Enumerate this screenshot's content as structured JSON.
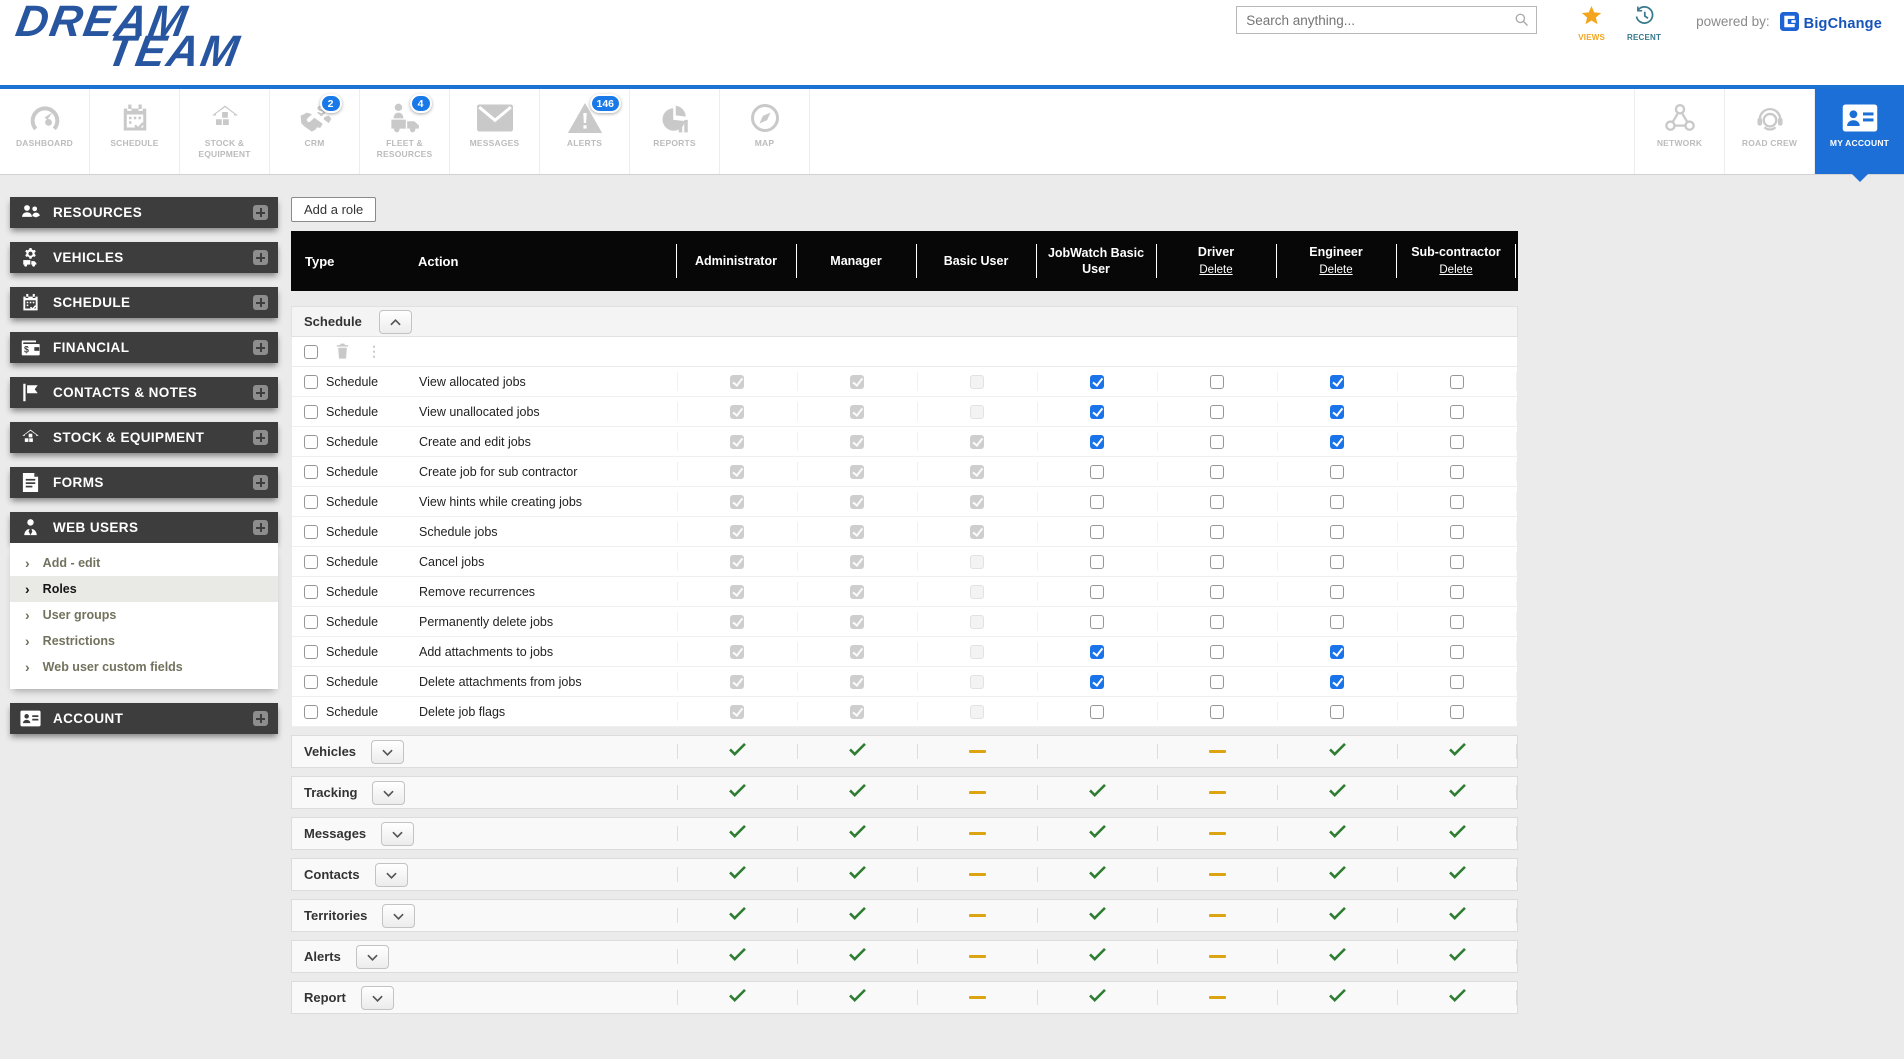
{
  "brand": {
    "logo_line1": "DREAM",
    "logo_line2": "TEAM",
    "powered_by": "powered by:",
    "powered_brand": "BigChange"
  },
  "topbar": {
    "search_placeholder": "Search anything...",
    "views_label": "VIEWS",
    "recent_label": "RECENT"
  },
  "colors": {
    "accent_blue": "#1b6fd6",
    "checkbox_blue": "#1a73e8",
    "check_green": "#2e7d32",
    "dash_orange": "#dba412",
    "header_black": "#070707",
    "sidebar_dark": "#3d3d3d"
  },
  "nav": {
    "items": [
      {
        "label": "DASHBOARD",
        "icon": "dashboard-icon"
      },
      {
        "label": "SCHEDULE",
        "icon": "schedule-icon"
      },
      {
        "label": "STOCK & EQUIPMENT",
        "icon": "stock-equipment-icon"
      },
      {
        "label": "CRM",
        "icon": "crm-icon",
        "badge": "2"
      },
      {
        "label": "FLEET & RESOURCES",
        "icon": "fleet-resources-icon",
        "badge": "4"
      },
      {
        "label": "MESSAGES",
        "icon": "messages-icon"
      },
      {
        "label": "ALERTS",
        "icon": "alerts-icon",
        "badge": "146"
      },
      {
        "label": "REPORTS",
        "icon": "reports-icon"
      },
      {
        "label": "MAP",
        "icon": "map-icon"
      }
    ],
    "right_items": [
      {
        "label": "NETWORK",
        "icon": "network-icon"
      },
      {
        "label": "ROAD CREW",
        "icon": "road-crew-icon"
      },
      {
        "label": "MY ACCOUNT",
        "icon": "my-account-icon",
        "active": true
      }
    ]
  },
  "sidebar": {
    "sections": [
      {
        "label": "RESOURCES",
        "icon": "resources-icon"
      },
      {
        "label": "VEHICLES",
        "icon": "vehicles-icon"
      },
      {
        "label": "SCHEDULE",
        "icon": "schedule-calendar-icon"
      },
      {
        "label": "FINANCIAL",
        "icon": "financial-icon"
      },
      {
        "label": "CONTACTS & NOTES",
        "icon": "contacts-notes-icon"
      },
      {
        "label": "STOCK & EQUIPMENT",
        "icon": "stock-icon"
      },
      {
        "label": "FORMS",
        "icon": "forms-icon"
      },
      {
        "label": "WEB USERS",
        "icon": "web-users-icon",
        "submenu": [
          {
            "label": "Add - edit",
            "selected": false
          },
          {
            "label": "Roles",
            "selected": true
          },
          {
            "label": "User groups",
            "selected": false
          },
          {
            "label": "Restrictions",
            "selected": false
          },
          {
            "label": "Web user custom fields",
            "selected": false
          }
        ]
      },
      {
        "label": "ACCOUNT",
        "icon": "account-icon"
      }
    ]
  },
  "main": {
    "add_role_button": "Add a role",
    "table": {
      "type_header": "Type",
      "action_header": "Action",
      "roles": [
        {
          "name": "Administrator"
        },
        {
          "name": "Manager"
        },
        {
          "name": "Basic User"
        },
        {
          "name": "JobWatch Basic User"
        },
        {
          "name": "Driver",
          "delete_label": "Delete"
        },
        {
          "name": "Engineer",
          "delete_label": "Delete"
        },
        {
          "name": "Sub-contractor",
          "delete_label": "Delete"
        }
      ],
      "expanded_section": {
        "label": "Schedule",
        "rows": [
          {
            "type": "Schedule",
            "action": "View allocated jobs",
            "states": [
              "dc",
              "dc",
              "du",
              "c",
              "u",
              "c",
              "u"
            ]
          },
          {
            "type": "Schedule",
            "action": "View unallocated jobs",
            "states": [
              "dc",
              "dc",
              "du",
              "c",
              "u",
              "c",
              "u"
            ]
          },
          {
            "type": "Schedule",
            "action": "Create and edit jobs",
            "states": [
              "dc",
              "dc",
              "dc",
              "c",
              "u",
              "c",
              "u"
            ]
          },
          {
            "type": "Schedule",
            "action": "Create job for sub contractor",
            "states": [
              "dc",
              "dc",
              "dc",
              "u",
              "u",
              "u",
              "u"
            ]
          },
          {
            "type": "Schedule",
            "action": "View hints while creating jobs",
            "states": [
              "dc",
              "dc",
              "dc",
              "u",
              "u",
              "u",
              "u"
            ]
          },
          {
            "type": "Schedule",
            "action": "Schedule jobs",
            "states": [
              "dc",
              "dc",
              "dc",
              "u",
              "u",
              "u",
              "u"
            ]
          },
          {
            "type": "Schedule",
            "action": "Cancel jobs",
            "states": [
              "dc",
              "dc",
              "du",
              "u",
              "u",
              "u",
              "u"
            ]
          },
          {
            "type": "Schedule",
            "action": "Remove recurrences",
            "states": [
              "dc",
              "dc",
              "du",
              "u",
              "u",
              "u",
              "u"
            ]
          },
          {
            "type": "Schedule",
            "action": "Permanently delete jobs",
            "states": [
              "dc",
              "dc",
              "du",
              "u",
              "u",
              "u",
              "u"
            ]
          },
          {
            "type": "Schedule",
            "action": "Add attachments to jobs",
            "states": [
              "dc",
              "dc",
              "du",
              "c",
              "u",
              "c",
              "u"
            ]
          },
          {
            "type": "Schedule",
            "action": "Delete attachments from jobs",
            "states": [
              "dc",
              "dc",
              "du",
              "c",
              "u",
              "c",
              "u"
            ]
          },
          {
            "type": "Schedule",
            "action": "Delete job flags",
            "states": [
              "dc",
              "dc",
              "du",
              "u",
              "u",
              "u",
              "u"
            ]
          }
        ]
      },
      "collapsed_sections": [
        {
          "label": "Vehicles",
          "marks": [
            "check",
            "check",
            "dash",
            "none",
            "dash",
            "check",
            "check"
          ]
        },
        {
          "label": "Tracking",
          "marks": [
            "check",
            "check",
            "dash",
            "check",
            "dash",
            "check",
            "check"
          ]
        },
        {
          "label": "Messages",
          "marks": [
            "check",
            "check",
            "dash",
            "check",
            "dash",
            "check",
            "check"
          ]
        },
        {
          "label": "Contacts",
          "marks": [
            "check",
            "check",
            "dash",
            "check",
            "dash",
            "check",
            "check"
          ]
        },
        {
          "label": "Territories",
          "marks": [
            "check",
            "check",
            "dash",
            "check",
            "dash",
            "check",
            "check"
          ]
        },
        {
          "label": "Alerts",
          "marks": [
            "check",
            "check",
            "dash",
            "check",
            "dash",
            "check",
            "check"
          ]
        },
        {
          "label": "Report",
          "marks": [
            "check",
            "check",
            "dash",
            "check",
            "dash",
            "check",
            "check"
          ]
        }
      ]
    }
  }
}
